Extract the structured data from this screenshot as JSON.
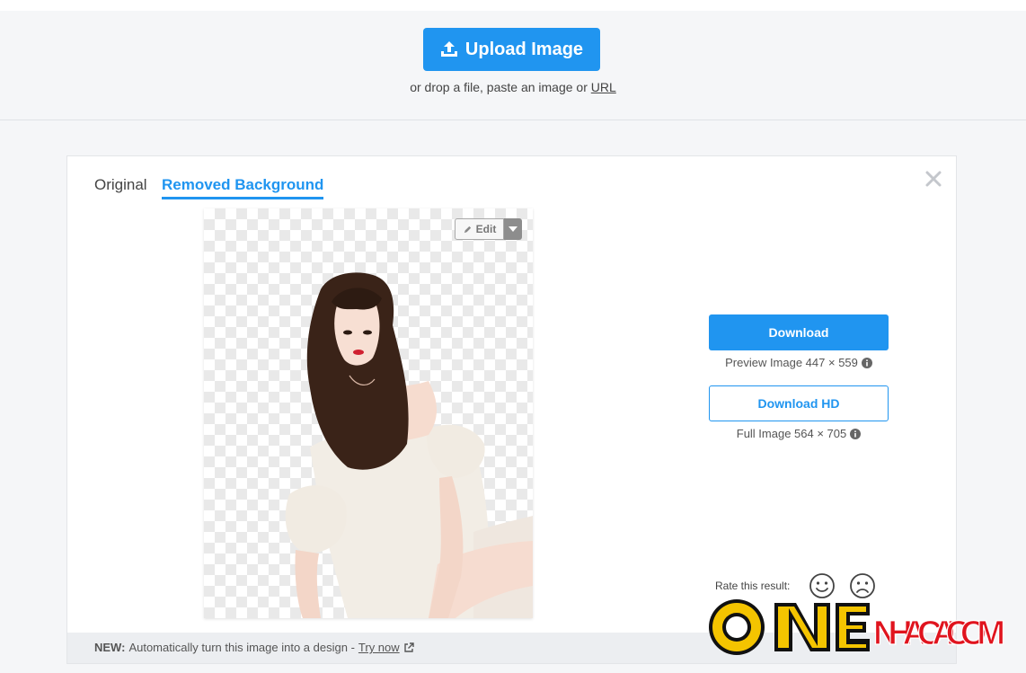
{
  "upload": {
    "button_label": "Upload Image",
    "hint_prefix": "or drop a file, paste an image or",
    "hint_link": "URL",
    "icon": "upload-icon"
  },
  "tabs": [
    {
      "label": "Original",
      "active": false
    },
    {
      "label": "Removed Background",
      "active": true
    }
  ],
  "editor": {
    "edit_label": "Edit",
    "edit_icon": "pencil-icon",
    "caret_icon": "caret-down-icon"
  },
  "downloads": {
    "download_label": "Download",
    "preview_caption": "Preview Image 447 × 559",
    "download_hd_label": "Download HD",
    "full_caption": "Full Image 564 × 705",
    "info_icon": "info-icon"
  },
  "rating": {
    "label": "Rate this result:",
    "options": [
      "smile-icon",
      "frown-icon"
    ]
  },
  "footer": {
    "new_tag": "NEW:",
    "text": "Automatically turn this image into a design -",
    "link": "Try now",
    "link_icon": "external-link-icon"
  },
  "watermark": {
    "text": "ONENHACAI.COM"
  },
  "colors": {
    "accent": "#2095f0",
    "background": "#f5f6f8",
    "card": "#ffffff",
    "watermark_yellow": "#f4c400",
    "watermark_red": "#e0141e"
  }
}
